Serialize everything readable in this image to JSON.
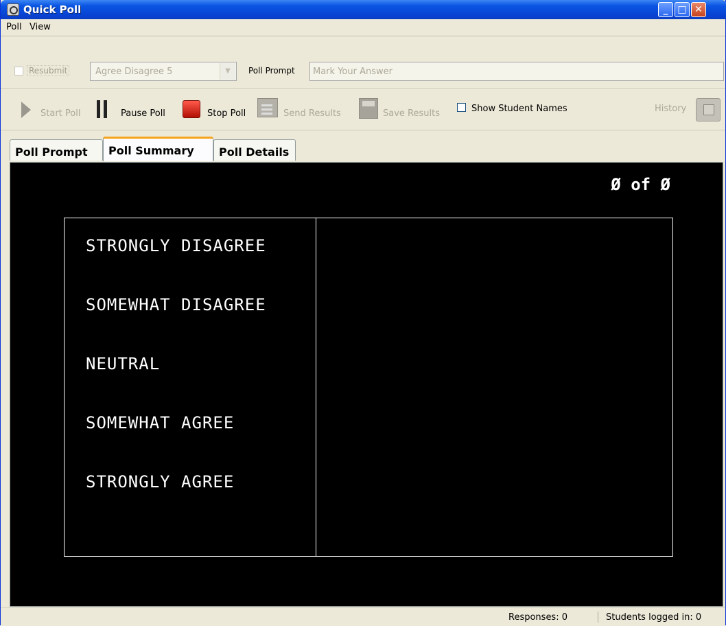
{
  "window": {
    "title": "Quick Poll"
  },
  "menu": {
    "poll": "Poll",
    "view": "View"
  },
  "options": {
    "resubmit_label": "Resubmit",
    "answer_set": "Agree Disagree 5",
    "poll_prompt_label": "Poll Prompt",
    "poll_prompt_value": "Mark Your Answer"
  },
  "toolbar": {
    "start": "Start Poll",
    "pause": "Pause Poll",
    "stop": "Stop Poll",
    "send": "Send Results",
    "save": "Save Results",
    "show_names": "Show Student Names",
    "history": "History"
  },
  "tabs": [
    "Poll Prompt",
    "Poll Summary",
    "Poll Details"
  ],
  "summary": {
    "counter": "Ø of Ø",
    "answers": [
      "STRONGLY DISAGREE",
      "SOMEWHAT DISAGREE",
      "NEUTRAL",
      "SOMEWHAT AGREE",
      "STRONGLY AGREE"
    ]
  },
  "status": {
    "responses": "Responses: 0",
    "students": "Students logged in: 0"
  },
  "colors": {
    "title_bar": "#0a55e3",
    "active_tab_accent": "#f7a31c",
    "stop_button": "#d3261b",
    "canvas": "#000000"
  }
}
